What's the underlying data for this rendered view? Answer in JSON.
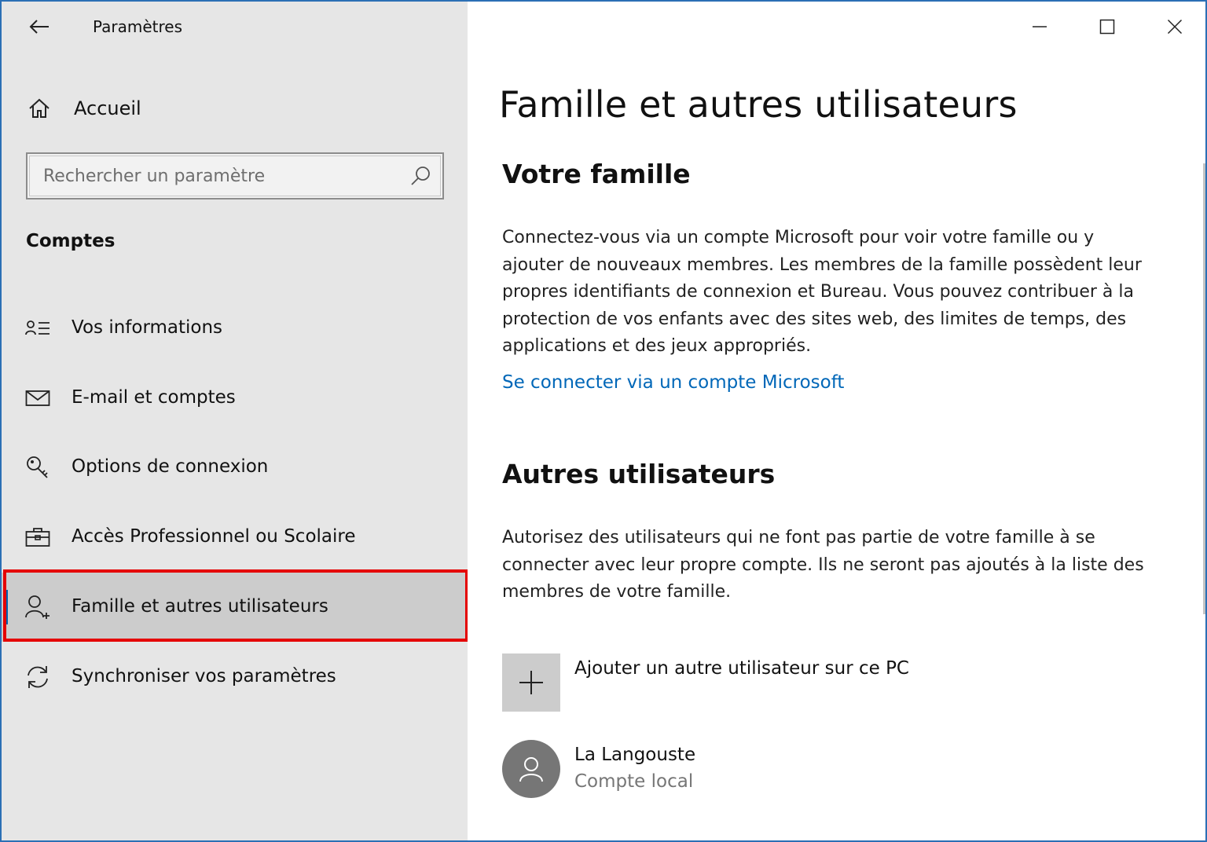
{
  "window": {
    "app_title": "Paramètres"
  },
  "sidebar": {
    "home_label": "Accueil",
    "search_placeholder": "Rechercher un paramètre",
    "section_heading": "Comptes",
    "items": [
      {
        "label": "Vos informations",
        "icon": "person-list-icon"
      },
      {
        "label": "E-mail et comptes",
        "icon": "mail-icon"
      },
      {
        "label": "Options de connexion",
        "icon": "key-icon"
      },
      {
        "label": "Accès Professionnel ou Scolaire",
        "icon": "briefcase-icon"
      },
      {
        "label": "Famille et autres utilisateurs",
        "icon": "person-add-icon",
        "selected": true
      },
      {
        "label": "Synchroniser vos paramètres",
        "icon": "sync-icon"
      }
    ]
  },
  "main": {
    "page_title": "Famille et autres utilisateurs",
    "family": {
      "heading": "Votre famille",
      "description": "Connectez-vous via un compte Microsoft pour voir votre famille ou y ajouter de nouveaux membres. Les membres de la famille possèdent leur propres identifiants de connexion et Bureau. Vous pouvez contribuer à la protection de vos enfants avec des sites web, des limites de temps, des applications et des jeux appropriés.",
      "link": "Se connecter via un compte Microsoft"
    },
    "others": {
      "heading": "Autres utilisateurs",
      "description": "Autorisez des utilisateurs qui ne font pas partie de votre famille à se connecter avec leur propre compte. Ils ne seront pas ajoutés à la liste des membres de votre famille.",
      "add_label": "Ajouter un autre utilisateur sur ce PC",
      "users": [
        {
          "name": "La Langouste",
          "type": "Compte local"
        }
      ]
    }
  },
  "colors": {
    "accent": "#0063b1",
    "link": "#0067b8",
    "highlight": "#e50000",
    "sidebar_bg": "#e6e6e6",
    "selected_bg": "#cccccc"
  }
}
